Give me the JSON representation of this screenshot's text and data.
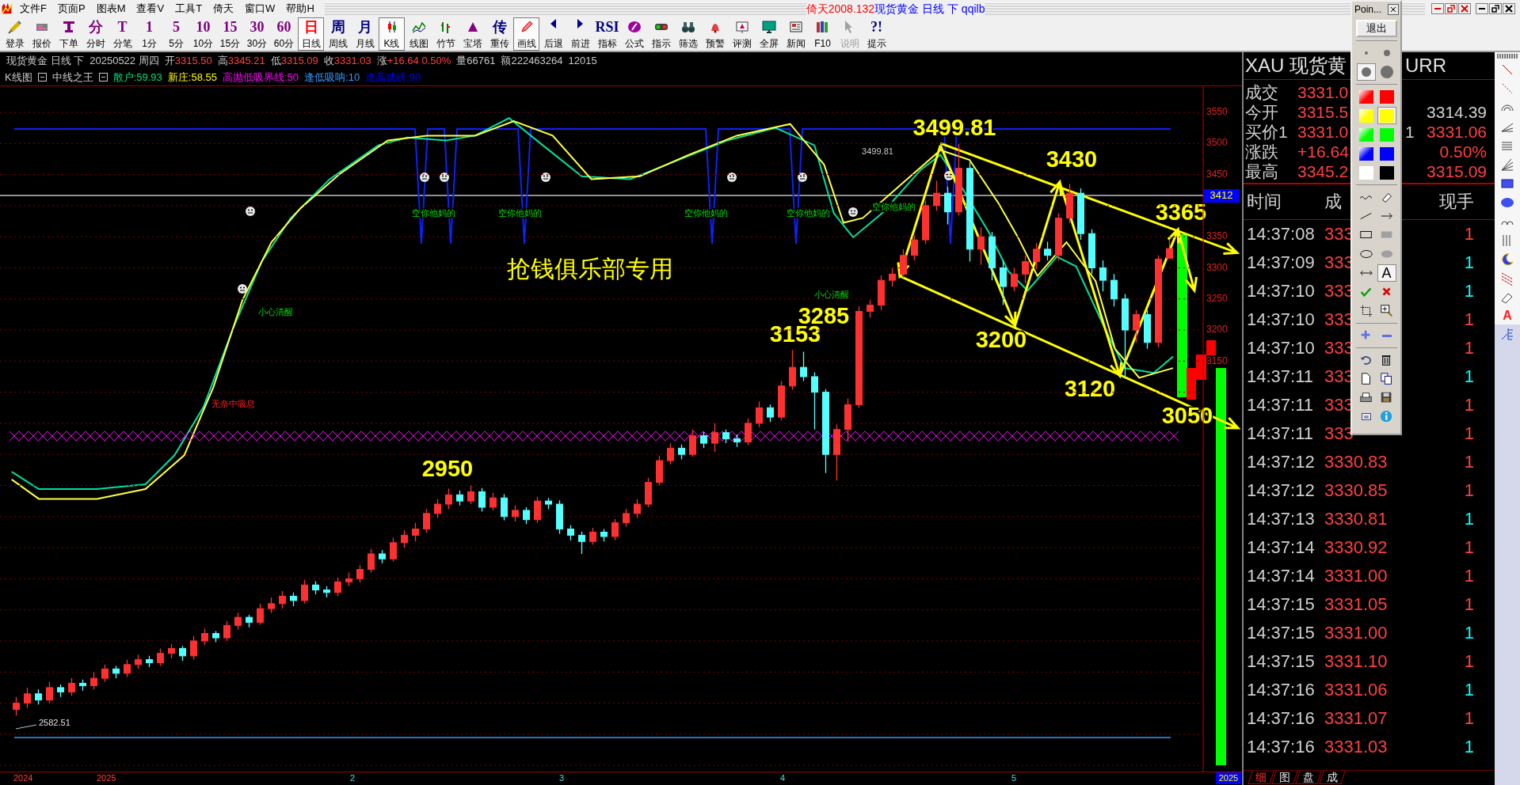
{
  "menu": {
    "items": [
      "文件F",
      "页面P",
      "图表M",
      "查看V",
      "工具T",
      "倚天",
      "窗口W",
      "帮助H"
    ]
  },
  "title": {
    "app": "倚天2008.132",
    "document": "现货黄金 日线 下 qqilb"
  },
  "toolbar": {
    "buttons": [
      {
        "label": "登录",
        "kind": "icon",
        "selected": false,
        "disabled": false
      },
      {
        "label": "报价",
        "kind": "icon",
        "selected": false,
        "disabled": false
      },
      {
        "label": "下单",
        "kind": "icon",
        "selected": false,
        "disabled": false
      },
      {
        "label": "分时",
        "kind": "glyph",
        "glyph": "分",
        "color": "#800080",
        "selected": false,
        "disabled": false
      },
      {
        "label": "分笔",
        "kind": "glyph",
        "glyph": "T",
        "color": "#800080",
        "selected": false,
        "disabled": false
      },
      {
        "label": "1分",
        "kind": "glyph",
        "glyph": "1",
        "color": "#800080",
        "selected": false,
        "disabled": false
      },
      {
        "label": "5分",
        "kind": "glyph",
        "glyph": "5",
        "color": "#800080",
        "selected": false,
        "disabled": false
      },
      {
        "label": "10分",
        "kind": "glyph",
        "glyph": "10",
        "color": "#800080",
        "selected": false,
        "disabled": false
      },
      {
        "label": "15分",
        "kind": "glyph",
        "glyph": "15",
        "color": "#800080",
        "selected": false,
        "disabled": false
      },
      {
        "label": "30分",
        "kind": "glyph",
        "glyph": "30",
        "color": "#800080",
        "selected": false,
        "disabled": false
      },
      {
        "label": "60分",
        "kind": "glyph",
        "glyph": "60",
        "color": "#800080",
        "selected": false,
        "disabled": false
      },
      {
        "label": "日线",
        "kind": "glyph",
        "glyph": "日",
        "color": "#ff0000",
        "selected": true,
        "disabled": false
      },
      {
        "label": "周线",
        "kind": "glyph",
        "glyph": "周",
        "color": "#000080",
        "selected": false,
        "disabled": false
      },
      {
        "label": "月线",
        "kind": "glyph",
        "glyph": "月",
        "color": "#000080",
        "selected": false,
        "disabled": false
      },
      {
        "label": "K线",
        "kind": "icon",
        "selected": true,
        "disabled": false
      },
      {
        "label": "线图",
        "kind": "icon",
        "selected": false,
        "disabled": false
      },
      {
        "label": "竹节",
        "kind": "icon",
        "selected": false,
        "disabled": false
      },
      {
        "label": "宝塔",
        "kind": "icon",
        "selected": false,
        "disabled": false
      },
      {
        "label": "重传",
        "kind": "glyph",
        "glyph": "传",
        "color": "#000080",
        "selected": false,
        "disabled": false
      },
      {
        "label": "画线",
        "kind": "icon",
        "selected": true,
        "disabled": false
      },
      {
        "label": "后退",
        "kind": "icon",
        "selected": false,
        "disabled": false
      },
      {
        "label": "前进",
        "kind": "icon",
        "selected": false,
        "disabled": false
      },
      {
        "label": "指标",
        "kind": "glyph",
        "glyph": "RSI",
        "color": "#000080",
        "selected": false,
        "disabled": false
      },
      {
        "label": "公式",
        "kind": "icon",
        "selected": false,
        "disabled": false
      },
      {
        "label": "指示",
        "kind": "icon",
        "selected": false,
        "disabled": false
      },
      {
        "label": "筛选",
        "kind": "icon",
        "selected": false,
        "disabled": false
      },
      {
        "label": "预警",
        "kind": "icon",
        "selected": false,
        "disabled": false
      },
      {
        "label": "评测",
        "kind": "icon",
        "selected": false,
        "disabled": false
      },
      {
        "label": "全屏",
        "kind": "icon",
        "selected": false,
        "disabled": false
      },
      {
        "label": "新闻",
        "kind": "icon",
        "selected": false,
        "disabled": false
      },
      {
        "label": "F10",
        "kind": "icon",
        "selected": false,
        "disabled": false
      },
      {
        "label": "说明",
        "kind": "icon",
        "selected": false,
        "disabled": true
      },
      {
        "label": "提示",
        "kind": "glyph",
        "glyph": "?!",
        "color": "#000080",
        "selected": false,
        "disabled": false
      }
    ]
  },
  "quote_line": {
    "symbol": "现货黄金 日线 下",
    "date": "20250522 周四",
    "fields": [
      {
        "label": "开",
        "value": "3315.50",
        "kind": "price"
      },
      {
        "label": "高",
        "value": "3345.21",
        "kind": "price"
      },
      {
        "label": "低",
        "value": "3315.09",
        "kind": "price"
      },
      {
        "label": "收",
        "value": "3331.03",
        "kind": "price"
      },
      {
        "label": "涨",
        "value": "+16.64 0.50%",
        "kind": "price"
      },
      {
        "label": "量",
        "value": "66761",
        "kind": "plain"
      },
      {
        "label": "额",
        "value": "222463264",
        "kind": "plain"
      }
    ],
    "trailing": "12015"
  },
  "indicator_line": {
    "chart_name": "K线图",
    "indicator_name": "中线之王",
    "values": [
      {
        "text": "散户:59.93",
        "color": "#00e070"
      },
      {
        "text": "新庄:58.55",
        "color": "#ffff00"
      },
      {
        "text": "高抛低吸界线:50",
        "color": "#ff00ff"
      },
      {
        "text": "逢低吸呐:10",
        "color": "#3399ff"
      },
      {
        "text": "逢高减磅:90",
        "color": "#0000ff"
      }
    ]
  },
  "chart": {
    "chart_data": {
      "type": "candlestick",
      "ylim": [
        2490,
        3592
      ],
      "grid": true,
      "yticks": [
        3550,
        3500,
        3450,
        3350,
        3300,
        3250,
        3200,
        3150
      ],
      "ohlc": [
        [
          2590,
          2610,
          2580,
          2600
        ],
        [
          2600,
          2625,
          2592,
          2615
        ],
        [
          2615,
          2622,
          2598,
          2605
        ],
        [
          2605,
          2634,
          2600,
          2625
        ],
        [
          2625,
          2630,
          2610,
          2618
        ],
        [
          2618,
          2640,
          2612,
          2632
        ],
        [
          2632,
          2638,
          2620,
          2628
        ],
        [
          2628,
          2650,
          2622,
          2640
        ],
        [
          2640,
          2662,
          2634,
          2655
        ],
        [
          2655,
          2660,
          2640,
          2648
        ],
        [
          2648,
          2670,
          2642,
          2662
        ],
        [
          2662,
          2678,
          2655,
          2670
        ],
        [
          2670,
          2676,
          2658,
          2665
        ],
        [
          2665,
          2688,
          2660,
          2680
        ],
        [
          2680,
          2695,
          2672,
          2688
        ],
        [
          2688,
          2692,
          2668,
          2676
        ],
        [
          2676,
          2708,
          2670,
          2700
        ],
        [
          2700,
          2720,
          2694,
          2712
        ],
        [
          2712,
          2716,
          2698,
          2705
        ],
        [
          2705,
          2732,
          2700,
          2725
        ],
        [
          2725,
          2745,
          2718,
          2738
        ],
        [
          2738,
          2742,
          2722,
          2730
        ],
        [
          2730,
          2760,
          2726,
          2752
        ],
        [
          2752,
          2770,
          2745,
          2760
        ],
        [
          2760,
          2780,
          2752,
          2772
        ],
        [
          2772,
          2778,
          2756,
          2765
        ],
        [
          2765,
          2798,
          2760,
          2790
        ],
        [
          2790,
          2796,
          2775,
          2782
        ],
        [
          2782,
          2788,
          2770,
          2778
        ],
        [
          2778,
          2802,
          2772,
          2795
        ],
        [
          2795,
          2810,
          2788,
          2800
        ],
        [
          2800,
          2822,
          2794,
          2815
        ],
        [
          2815,
          2848,
          2810,
          2840
        ],
        [
          2840,
          2846,
          2825,
          2832
        ],
        [
          2832,
          2866,
          2828,
          2858
        ],
        [
          2858,
          2878,
          2850,
          2870
        ],
        [
          2870,
          2890,
          2860,
          2880
        ],
        [
          2880,
          2912,
          2874,
          2905
        ],
        [
          2905,
          2928,
          2898,
          2920
        ],
        [
          2920,
          2945,
          2912,
          2935
        ],
        [
          2935,
          2942,
          2918,
          2925
        ],
        [
          2925,
          2950,
          2920,
          2940
        ],
        [
          2940,
          2946,
          2908,
          2915
        ],
        [
          2915,
          2938,
          2910,
          2930
        ],
        [
          2930,
          2936,
          2894,
          2900
        ],
        [
          2900,
          2918,
          2892,
          2910
        ],
        [
          2910,
          2915,
          2888,
          2895
        ],
        [
          2895,
          2932,
          2890,
          2925
        ],
        [
          2925,
          2930,
          2912,
          2920
        ],
        [
          2920,
          2926,
          2872,
          2880
        ],
        [
          2880,
          2886,
          2862,
          2870
        ],
        [
          2870,
          2876,
          2840,
          2860
        ],
        [
          2860,
          2882,
          2855,
          2875
        ],
        [
          2875,
          2880,
          2860,
          2868
        ],
        [
          2868,
          2896,
          2862,
          2890
        ],
        [
          2890,
          2912,
          2884,
          2905
        ],
        [
          2905,
          2928,
          2898,
          2920
        ],
        [
          2920,
          2962,
          2915,
          2955
        ],
        [
          2955,
          2998,
          2950,
          2990
        ],
        [
          2990,
          3018,
          2984,
          3010
        ],
        [
          3010,
          3016,
          2992,
          3000
        ],
        [
          3000,
          3040,
          2996,
          3030
        ],
        [
          3030,
          3036,
          3010,
          3018
        ],
        [
          3018,
          3050,
          3004,
          3035
        ],
        [
          3035,
          3040,
          3018,
          3025
        ],
        [
          3025,
          3032,
          3012,
          3020
        ],
        [
          3020,
          3058,
          3015,
          3050
        ],
        [
          3050,
          3085,
          3044,
          3075
        ],
        [
          3075,
          3080,
          3052,
          3060
        ],
        [
          3060,
          3118,
          3055,
          3110
        ],
        [
          3110,
          3168,
          3104,
          3140
        ],
        [
          3140,
          3165,
          3118,
          3125
        ],
        [
          3125,
          3132,
          3040,
          3100
        ],
        [
          3100,
          3105,
          2970,
          3000
        ],
        [
          3000,
          3048,
          2958,
          3040
        ],
        [
          3040,
          3090,
          3020,
          3080
        ],
        [
          3080,
          3238,
          3075,
          3230
        ],
        [
          3230,
          3248,
          3220,
          3240
        ],
        [
          3240,
          3288,
          3232,
          3280
        ],
        [
          3280,
          3300,
          3270,
          3290
        ],
        [
          3290,
          3330,
          3284,
          3320
        ],
        [
          3320,
          3352,
          3312,
          3345
        ],
        [
          3345,
          3408,
          3338,
          3400
        ],
        [
          3400,
          3440,
          3392,
          3420
        ],
        [
          3420,
          3430,
          3370,
          3390
        ],
        [
          3390,
          3499.81,
          3384,
          3460
        ],
        [
          3460,
          3470,
          3310,
          3330
        ],
        [
          3330,
          3365,
          3305,
          3350
        ],
        [
          3350,
          3358,
          3280,
          3300
        ],
        [
          3300,
          3312,
          3240,
          3270
        ],
        [
          3270,
          3300,
          3262,
          3290
        ],
        [
          3290,
          3320,
          3275,
          3310
        ],
        [
          3310,
          3340,
          3298,
          3330
        ],
        [
          3330,
          3342,
          3312,
          3320
        ],
        [
          3320,
          3388,
          3312,
          3380
        ],
        [
          3380,
          3435,
          3372,
          3420
        ],
        [
          3420,
          3428,
          3345,
          3355
        ],
        [
          3355,
          3362,
          3290,
          3300
        ],
        [
          3300,
          3312,
          3262,
          3280
        ],
        [
          3280,
          3290,
          3238,
          3250
        ],
        [
          3250,
          3258,
          3122,
          3200
        ],
        [
          3200,
          3232,
          3180,
          3225
        ],
        [
          3225,
          3232,
          3170,
          3180
        ],
        [
          3180,
          3320,
          3172,
          3314
        ],
        [
          3315.5,
          3345.21,
          3315.09,
          3331.03
        ]
      ]
    },
    "annotations": [
      {
        "text": "3499.81"
      },
      {
        "text": "3430"
      },
      {
        "text": "3365"
      },
      {
        "text": "3285"
      },
      {
        "text": "3153"
      },
      {
        "text": "2950"
      },
      {
        "text": "3200"
      },
      {
        "text": "3120"
      },
      {
        "text": "3050"
      }
    ],
    "price_tag": "3412",
    "overlay_text": "抢钱俱乐部专用",
    "high_marker": "3499.81",
    "low_marker": "2582.51",
    "signals": [
      {
        "text": "空你他妈的",
        "kind": "warning"
      },
      {
        "text": "空你他妈的",
        "kind": "warning"
      },
      {
        "text": "空你他妈的",
        "kind": "warning"
      },
      {
        "text": "空你他妈的",
        "kind": "warning"
      },
      {
        "text": "空你他妈的",
        "kind": "warning"
      },
      {
        "text": "小心清醒",
        "kind": "warning"
      },
      {
        "text": "小心清醒",
        "kind": "warning"
      },
      {
        "text": "无奈中吸息",
        "kind": "alert"
      }
    ]
  },
  "date_axis": {
    "labels": [
      {
        "text": "2024",
        "kind": "year"
      },
      {
        "text": "2025",
        "kind": "year"
      },
      {
        "text": "2",
        "kind": "month"
      },
      {
        "text": "3",
        "kind": "month"
      },
      {
        "text": "4",
        "kind": "month"
      },
      {
        "text": "5",
        "kind": "month"
      }
    ],
    "cursor_date": "2025"
  },
  "panel": {
    "header_left": "XAU 现货黄",
    "header_right": "URR",
    "quotes": [
      {
        "label": "成交",
        "value": {
          "text": "3331.0",
          "color": "#ff4040"
        }
      },
      {
        "label": "今开",
        "value": {
          "text": "3315.5",
          "color": "#ff4040"
        },
        "value_2": {
          "text": "3314.39",
          "color": "#d0d0d0"
        }
      },
      {
        "label": "买价1",
        "value": {
          "text": "3331.0",
          "color": "#ff4040"
        },
        "fragment": "1",
        "value_2": {
          "text": "3331.06",
          "color": "#ff4040"
        }
      },
      {
        "label": "涨跌",
        "value": {
          "text": "+16.64",
          "color": "#ff4040"
        },
        "value_2": {
          "text": "0.50%",
          "color": "#ff4040"
        }
      },
      {
        "label": "最高",
        "value": {
          "text": "3345.2",
          "color": "#ff4040"
        },
        "value_2": {
          "text": "3315.09",
          "color": "#ff4040"
        }
      }
    ],
    "trade_columns": [
      "时间",
      "成",
      "现手"
    ],
    "trades": [
      {
        "time": "14:37:08",
        "price": "333",
        "volume": "1",
        "color": "#ff4040"
      },
      {
        "time": "14:37:09",
        "price": "333",
        "volume": "1",
        "color": "#00ffff"
      },
      {
        "time": "14:37:10",
        "price": "333",
        "volume": "1",
        "color": "#00ffff"
      },
      {
        "time": "14:37:10",
        "price": "333",
        "volume": "1",
        "color": "#ff4040"
      },
      {
        "time": "14:37:10",
        "price": "333",
        "volume": "1",
        "color": "#ff4040"
      },
      {
        "time": "14:37:11",
        "price": "333",
        "volume": "1",
        "color": "#00ffff"
      },
      {
        "time": "14:37:11",
        "price": "333",
        "volume": "1",
        "color": "#ff4040"
      },
      {
        "time": "14:37:11",
        "price": "333",
        "volume": "1",
        "color": "#ff4040"
      },
      {
        "time": "14:37:12",
        "price": "3330.83",
        "volume": "1",
        "color": "#ff4040"
      },
      {
        "time": "14:37:12",
        "price": "3330.85",
        "volume": "1",
        "color": "#ff4040"
      },
      {
        "time": "14:37:13",
        "price": "3330.81",
        "volume": "1",
        "color": "#00ffff"
      },
      {
        "time": "14:37:14",
        "price": "3330.92",
        "volume": "1",
        "color": "#ff4040"
      },
      {
        "time": "14:37:14",
        "price": "3331.00",
        "volume": "1",
        "color": "#ff4040"
      },
      {
        "time": "14:37:15",
        "price": "3331.05",
        "volume": "1",
        "color": "#ff4040"
      },
      {
        "time": "14:37:15",
        "price": "3331.00",
        "volume": "1",
        "color": "#00ffff"
      },
      {
        "time": "14:37:15",
        "price": "3331.10",
        "volume": "1",
        "color": "#ff4040"
      },
      {
        "time": "14:37:16",
        "price": "3331.06",
        "volume": "1",
        "color": "#00ffff"
      },
      {
        "time": "14:37:16",
        "price": "3331.07",
        "volume": "1",
        "color": "#ff4040"
      },
      {
        "time": "14:37:16",
        "price": "3331.03",
        "volume": "1",
        "color": "#00ffff"
      }
    ],
    "tabs": [
      {
        "label": "细",
        "selected": true
      },
      {
        "label": "图",
        "selected": false
      },
      {
        "label": "盘",
        "selected": false
      },
      {
        "label": "成",
        "selected": false
      }
    ]
  },
  "pointer_window": {
    "title": "Poin...",
    "exit_button": "退出",
    "dot_sizes": [
      {
        "selected": false
      },
      {
        "selected": false
      },
      {
        "selected": true
      },
      {
        "selected": false
      }
    ],
    "swatches": [
      {
        "color": "#ff0000",
        "kind": "gradient",
        "selected": false
      },
      {
        "color": "#ff0000",
        "kind": "solid",
        "selected": false
      },
      {
        "color": "#ffff00",
        "kind": "gradient",
        "selected": false
      },
      {
        "color": "#ffff00",
        "kind": "solid",
        "selected": true
      },
      {
        "color": "#00ff00",
        "kind": "gradient",
        "selected": false
      },
      {
        "color": "#00ff00",
        "kind": "solid",
        "selected": false
      },
      {
        "color": "#0000ff",
        "kind": "gradient",
        "selected": false
      },
      {
        "color": "#0000ff",
        "kind": "solid",
        "selected": false
      },
      {
        "color": "#ffffff",
        "kind": "solid",
        "selected": false
      },
      {
        "color": "#000000",
        "kind": "solid",
        "selected": false
      }
    ],
    "tools": [
      {
        "selected": false
      },
      {
        "selected": false
      },
      {
        "selected": false
      },
      {
        "selected": false
      },
      {
        "selected": false
      },
      {
        "selected": false
      },
      {
        "selected": false
      },
      {
        "selected": false
      },
      {
        "selected": false
      },
      {
        "glyph": "A",
        "selected": true
      },
      {
        "selected": false
      },
      {
        "selected": false
      },
      {
        "selected": false
      },
      {
        "selected": false
      }
    ]
  },
  "right_toolbar": {
    "text_glyph": "A"
  }
}
